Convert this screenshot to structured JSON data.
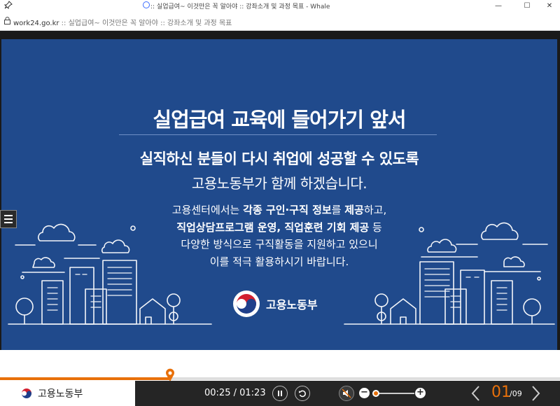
{
  "window": {
    "title": ":: 실업급여~ 이것만은 꼭 알아야 :: 강좌소개 및 과정 목표 - Whale",
    "controls": [
      "—",
      "☐",
      "✕"
    ]
  },
  "address": {
    "domain": "work24.go.kr",
    "separator": " :: ",
    "page_title": "실업급여~ 이것만은 꼭 알아야 :: 강좌소개 및 과정 목표"
  },
  "slide": {
    "heading": "실업급여 교육에 들어가기 앞서",
    "sub1": "실직하신 분들이 다시 취업에 성공할 수 있도록",
    "sub2": "고용노동부가 함께 하겠습니다.",
    "para": {
      "l1_a": "고용센터에서는 ",
      "l1_b": "각종 구인·구직 정보",
      "l1_c": "를 ",
      "l1_d": "제공",
      "l1_e": "하고,",
      "l2_a": "직업상담프로그램 운영, 직업훈련 기회 제공",
      "l2_b": " 등",
      "l3": "다양한 방식으로 구직활동을 지원하고 있으니",
      "l4": "이를 적극 활용하시기 바랍니다."
    },
    "logo_text": "고용노동부"
  },
  "player": {
    "progress_fraction": 0.304,
    "brand": "고용노동부",
    "time_current": "00:25",
    "time_sep": " / ",
    "time_total": "01:23",
    "volume_fraction": 0.05,
    "volume_minus": "−",
    "volume_plus": "+",
    "page_current": "01",
    "page_total": "/09"
  },
  "colors": {
    "slide_bg": "#204a8c",
    "accent": "#e8700a",
    "controlbar_bg": "#252525"
  }
}
